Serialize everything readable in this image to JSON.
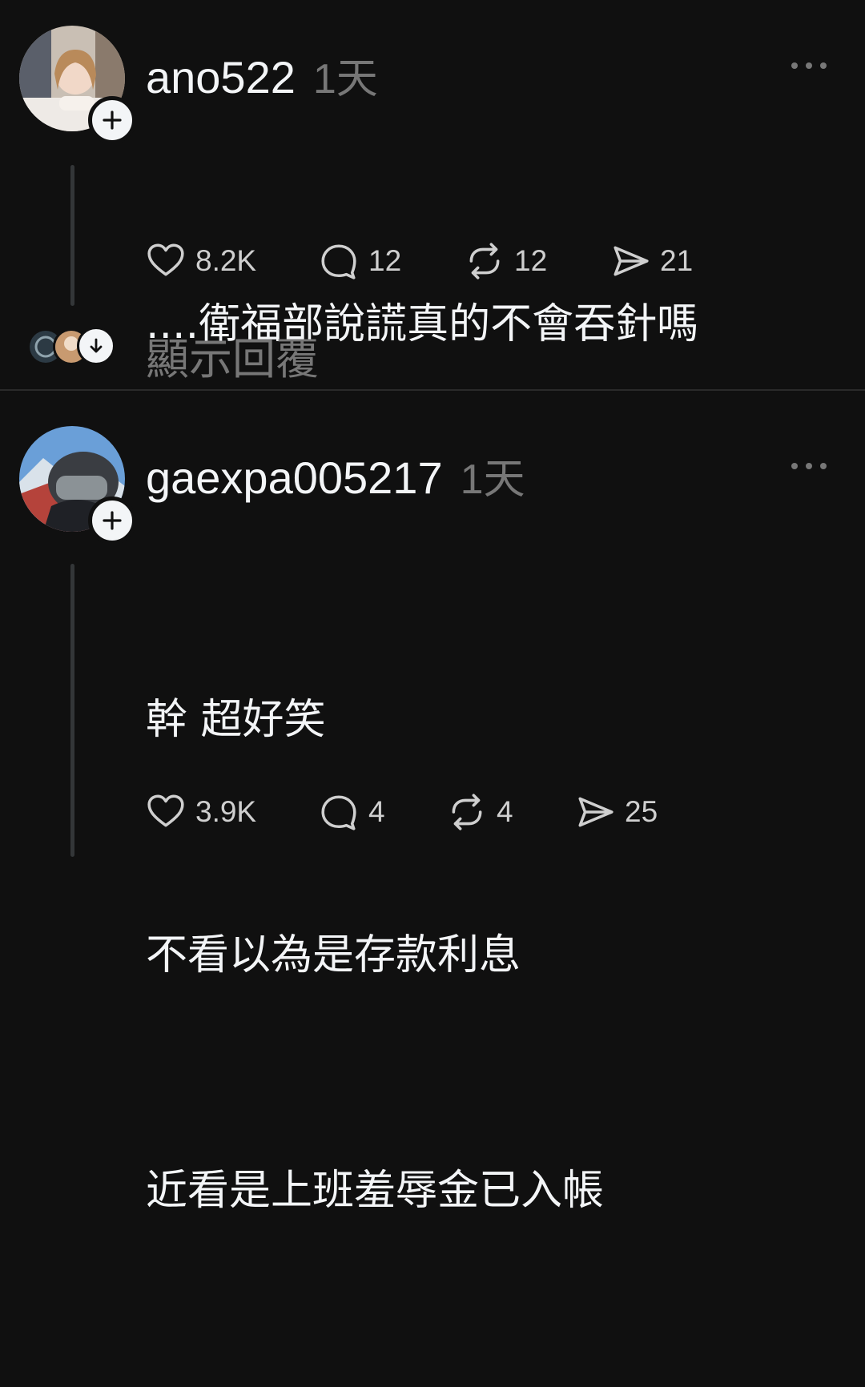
{
  "posts": [
    {
      "username": "ano522",
      "time": "1天",
      "lines": [
        "....衛福部說謊真的不會吞針嗎"
      ],
      "likes": "8.2K",
      "comments": "12",
      "reposts": "12",
      "shares": "21"
    },
    {
      "username": "gaexpa005217",
      "time": "1天",
      "lines": [
        "幹 超好笑",
        "不看以為是存款利息",
        "近看是上班羞辱金已入帳"
      ],
      "likes": "3.9K",
      "comments": "4",
      "reposts": "4",
      "shares": "25"
    }
  ],
  "show_replies": {
    "label": "顯示回覆"
  },
  "icons": {
    "more": "more-horizontal-icon",
    "like": "heart-icon",
    "comment": "comment-bubble-icon",
    "repost": "repost-icon",
    "share": "send-icon",
    "follow": "plus-icon",
    "expand": "arrow-down-icon"
  },
  "colors": {
    "background": "#101010",
    "text": "#f3f5f7",
    "muted": "#777777"
  }
}
